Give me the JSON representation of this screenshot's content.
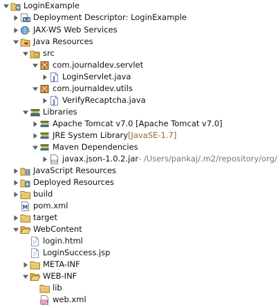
{
  "tree": {
    "nodes": [
      {
        "id": "LoginExample",
        "label": "LoginExample",
        "depth": 0,
        "expanded": true,
        "icon": "web-project-icon"
      },
      {
        "id": "dd",
        "label": "Deployment Descriptor: LoginExample",
        "depth": 1,
        "expanded": false,
        "icon": "deployment-descriptor-icon"
      },
      {
        "id": "jaxws",
        "label": "JAX-WS Web Services",
        "depth": 1,
        "expanded": false,
        "icon": "web-services-icon"
      },
      {
        "id": "javares",
        "label": "Java Resources",
        "depth": 1,
        "expanded": true,
        "icon": "java-resources-icon"
      },
      {
        "id": "src",
        "label": "src",
        "depth": 2,
        "expanded": true,
        "icon": "source-folder-icon"
      },
      {
        "id": "pkg1",
        "label": "com.journaldev.servlet",
        "depth": 3,
        "expanded": true,
        "icon": "package-icon"
      },
      {
        "id": "f1",
        "label": "LoginServlet.java",
        "depth": 4,
        "expanded": false,
        "icon": "java-file-icon"
      },
      {
        "id": "pkg2",
        "label": "com.journaldev.utils",
        "depth": 3,
        "expanded": true,
        "icon": "package-icon"
      },
      {
        "id": "f2",
        "label": "VerifyRecaptcha.java",
        "depth": 4,
        "expanded": false,
        "icon": "java-file-icon"
      },
      {
        "id": "libs",
        "label": "Libraries",
        "depth": 2,
        "expanded": true,
        "icon": "libraries-icon"
      },
      {
        "id": "tomcat",
        "label": "Apache Tomcat v7.0 [Apache Tomcat v7.0]",
        "depth": 3,
        "expanded": false,
        "icon": "library-icon"
      },
      {
        "id": "jre",
        "label": "JRE System Library",
        "decoration": "[JavaSE-1.7]",
        "depth": 3,
        "expanded": false,
        "icon": "library-icon"
      },
      {
        "id": "maven",
        "label": "Maven Dependencies",
        "depth": 3,
        "expanded": true,
        "icon": "library-icon"
      },
      {
        "id": "jar",
        "label": "javax.json-1.0.2.jar",
        "decoration": " - /Users/pankaj/.m2/repository/org/",
        "depth": 4,
        "expanded": false,
        "icon": "jar-icon"
      },
      {
        "id": "jsres",
        "label": "JavaScript Resources",
        "depth": 1,
        "expanded": false,
        "icon": "javascript-resources-icon"
      },
      {
        "id": "deployed",
        "label": "Deployed Resources",
        "depth": 1,
        "expanded": false,
        "icon": "deployed-resources-icon"
      },
      {
        "id": "build",
        "label": "build",
        "depth": 1,
        "expanded": false,
        "icon": "folder-icon"
      },
      {
        "id": "pom",
        "label": "pom.xml",
        "depth": 1,
        "expanded": false,
        "icon": "maven-pom-icon"
      },
      {
        "id": "target",
        "label": "target",
        "depth": 1,
        "expanded": false,
        "icon": "folder-icon"
      },
      {
        "id": "webcontent",
        "label": "WebContent",
        "depth": 1,
        "expanded": true,
        "icon": "folder-open-icon"
      },
      {
        "id": "loginhtml",
        "label": "login.html",
        "depth": 2,
        "expanded": false,
        "icon": "file-icon"
      },
      {
        "id": "loginjsp",
        "label": "LoginSuccess.jsp",
        "depth": 2,
        "expanded": false,
        "icon": "file-icon"
      },
      {
        "id": "metainf",
        "label": "META-INF",
        "depth": 2,
        "expanded": false,
        "icon": "folder-icon"
      },
      {
        "id": "webinf",
        "label": "WEB-INF",
        "depth": 2,
        "expanded": true,
        "icon": "folder-open-icon"
      },
      {
        "id": "lib",
        "label": "lib",
        "depth": 3,
        "expanded": false,
        "icon": "folder-icon"
      },
      {
        "id": "webxml",
        "label": "web.xml",
        "depth": 3,
        "expanded": false,
        "icon": "xml-file-icon"
      }
    ]
  }
}
